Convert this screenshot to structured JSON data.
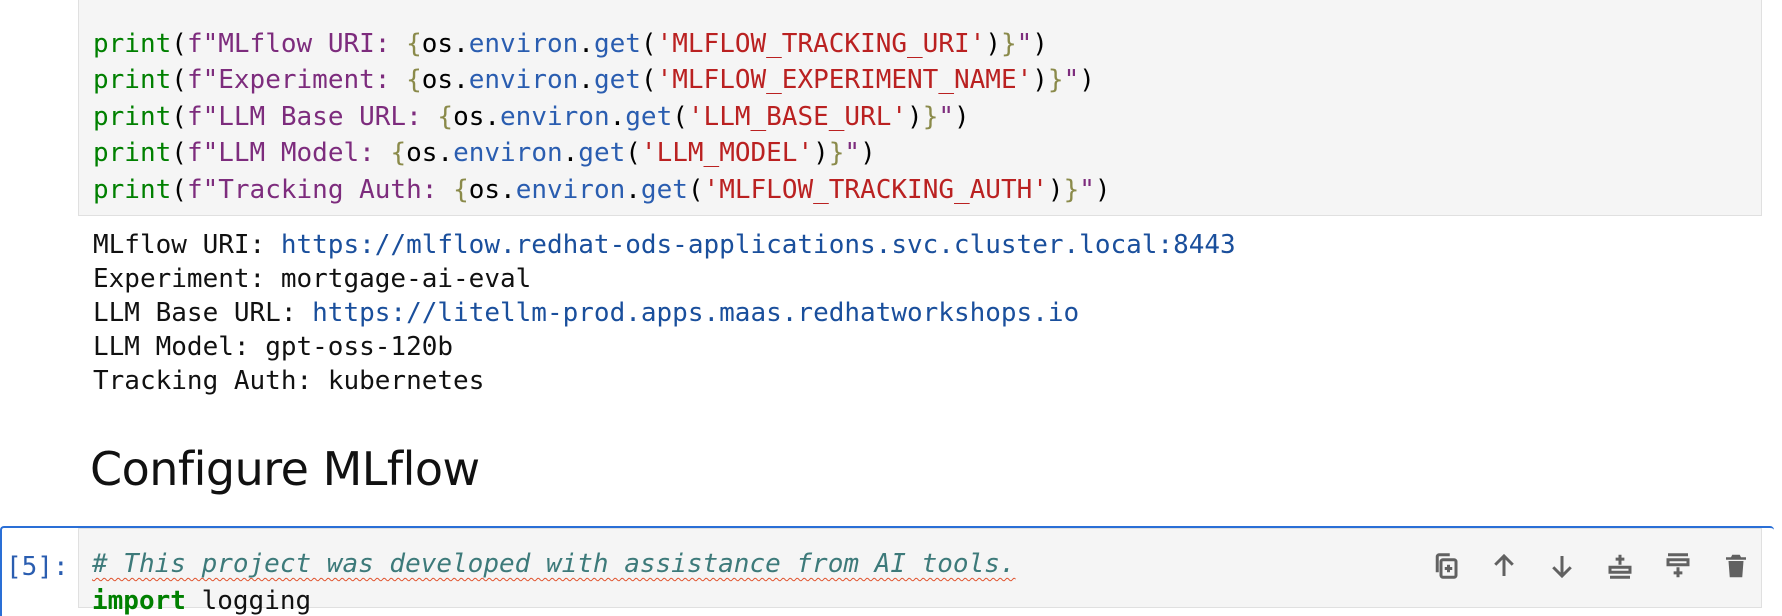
{
  "code_cell": {
    "lines": [
      {
        "label": "MLflow URI: ",
        "env": "'MLFLOW_TRACKING_URI'"
      },
      {
        "label": "Experiment: ",
        "env": "'MLFLOW_EXPERIMENT_NAME'"
      },
      {
        "label": "LLM Base URL: ",
        "env": "'LLM_BASE_URL'"
      },
      {
        "label": "LLM Model: ",
        "env": "'LLM_MODEL'"
      },
      {
        "label": "Tracking Auth: ",
        "env": "'MLFLOW_TRACKING_AUTH'"
      }
    ],
    "tokens": {
      "print": "print",
      "paren_open": "(",
      "fprefix": "f\"",
      "brace_open": "{",
      "os": "os",
      "dot": ".",
      "environ": "environ",
      "get": "get",
      "close_call": ")",
      "brace_close": "}",
      "quote": "\"",
      "paren_close": ")"
    }
  },
  "output": {
    "lines": [
      {
        "label": "MLflow URI: ",
        "value": "https://mlflow.redhat-ods-applications.svc.cluster.local:8443",
        "is_link": true
      },
      {
        "label": "Experiment: ",
        "value": "mortgage-ai-eval",
        "is_link": false
      },
      {
        "label": "LLM Base URL: ",
        "value": "https://litellm-prod.apps.maas.redhatworkshops.io",
        "is_link": true
      },
      {
        "label": "LLM Model: ",
        "value": "gpt-oss-120b",
        "is_link": false
      },
      {
        "label": "Tracking Auth: ",
        "value": "kubernetes",
        "is_link": false
      }
    ]
  },
  "markdown": {
    "heading": "Configure MLflow"
  },
  "active_cell": {
    "prompt": "[5]:",
    "comment": "# This project was developed with assistance from AI tools.",
    "next_keyword": "import",
    "next_rest": " logging"
  },
  "toolbar": {
    "icons": [
      "duplicate-icon",
      "move-up-icon",
      "move-down-icon",
      "insert-above-icon",
      "insert-below-icon",
      "delete-icon"
    ]
  },
  "colors": {
    "active_border": "#2a6fd6",
    "print_keyword": "#008000",
    "string": "#ba2121",
    "link": "#1a4f9c"
  }
}
